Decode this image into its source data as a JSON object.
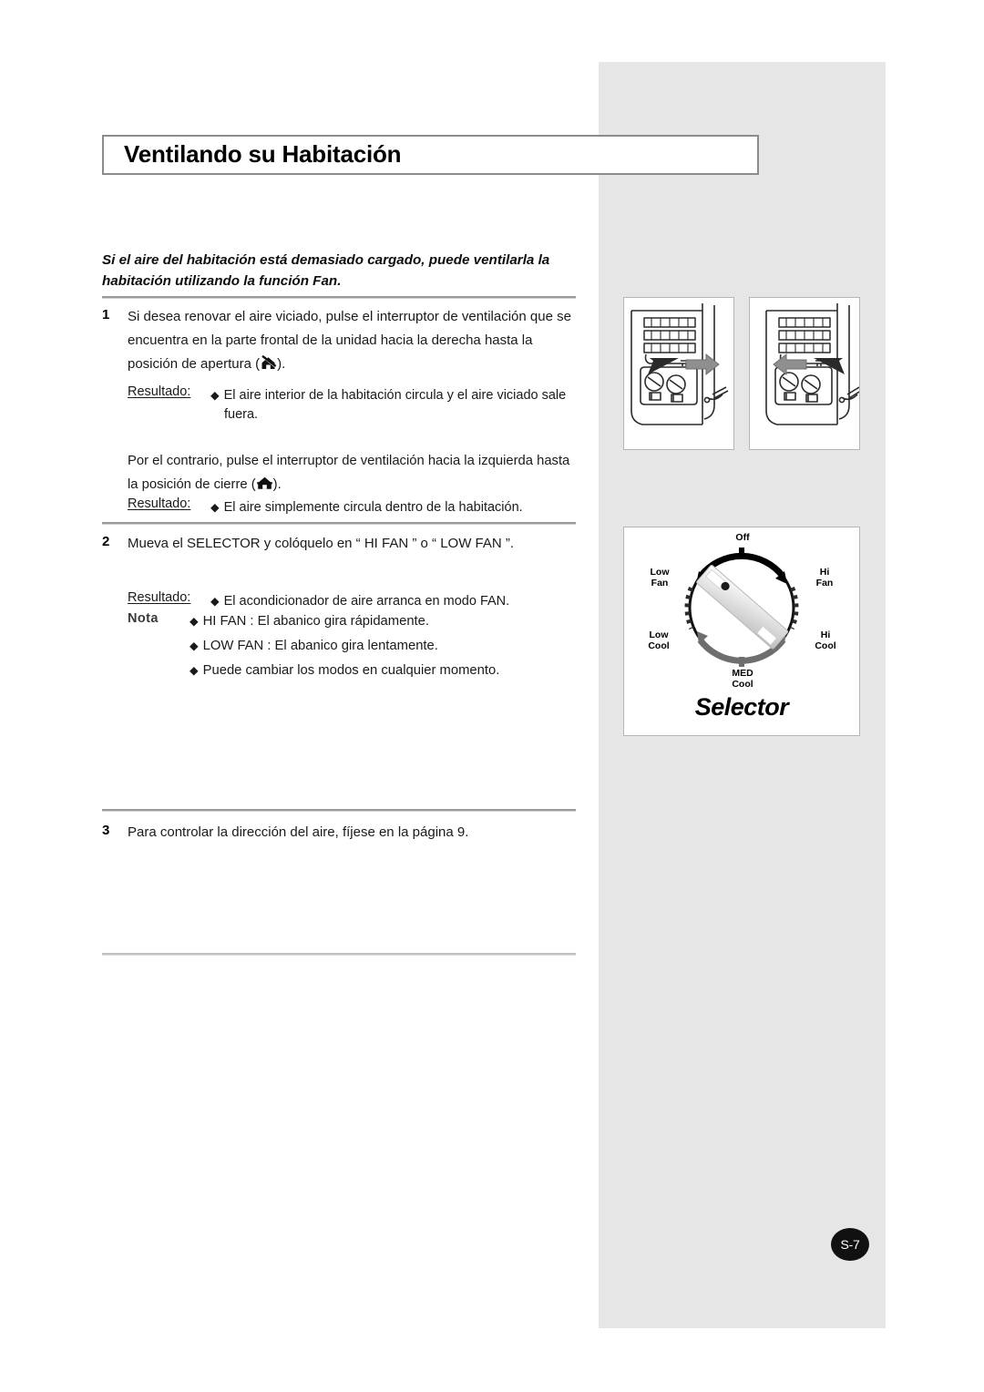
{
  "page": {
    "title": "Ventilando su Habitación",
    "badge": "S-7"
  },
  "intro": "Si el aire del habitación está demasiado cargado, puede ventilarla la habitación utilizando la función Fan.",
  "steps": [
    {
      "num": "1",
      "text": "Si desea renovar el aire viciado, pulse el interruptor de ventilación que se encuentra en la parte frontal de la unidad hacia la derecha hasta la posición de apertura (",
      "text_after": ").",
      "icon": "vent-open-icon",
      "result_label": "Resultado:",
      "result_text": "El aire interior de la habitación circula y el aire viciado sale",
      "result_cont": "fuera.",
      "para_before": "Por el contrario, pulse el interruptor de ventilación hacia la izquierda hasta la posición de cierre (",
      "para_after": ").",
      "para_icon": "vent-closed-icon",
      "result2_label": "Resultado:",
      "result2_text": "El aire simplemente circula dentro de la habitación."
    },
    {
      "num": "2",
      "text": "Mueva el SELECTOR y colóquelo en “ HI FAN ” o “ LOW FAN ”.",
      "result_label": "Resultado:",
      "result_text": "El acondicionador de aire arranca en modo FAN.",
      "note_label": "Nota",
      "notes": [
        "HI FAN : El abanico gira rápidamente.",
        "LOW FAN : El abanico gira lentamente.",
        "Puede cambiar los modos en cualquier momento."
      ]
    },
    {
      "num": "3",
      "text": "Para controlar la dirección del aire, fíjese en la página 9."
    }
  ],
  "selector": {
    "caption": "Selector",
    "labels": {
      "off": "Off",
      "low_fan": "Low\nFan",
      "hi_fan": "Hi\nFan",
      "low_cool": "Low\nCool",
      "hi_cool": "Hi\nCool",
      "med_cool": "MED\nCool"
    }
  },
  "illustrations": {
    "open_alt": "ventilation-switch-open",
    "close_alt": "ventilation-switch-closed"
  },
  "colors": {
    "panel_gray": "#e6e6e6",
    "rule_gray": "#9a9a9a",
    "badge_black": "#111111"
  }
}
